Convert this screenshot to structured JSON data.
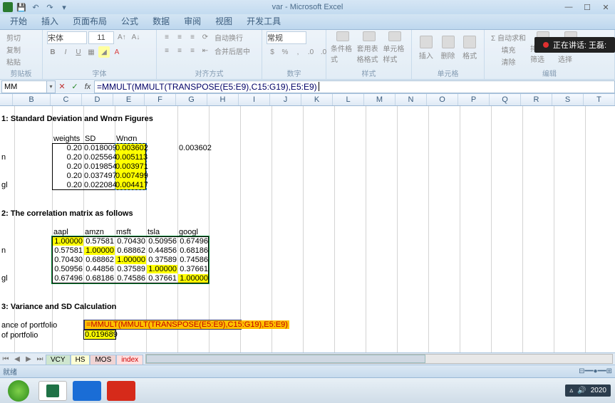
{
  "app": {
    "title": "var - Microsoft Excel"
  },
  "qat": {
    "save": "save",
    "undo": "undo",
    "redo": "redo"
  },
  "tabs": [
    "开始",
    "插入",
    "页面布局",
    "公式",
    "数据",
    "审阅",
    "视图",
    "开发工具"
  ],
  "clipboard": {
    "cut": "剪切",
    "copy": "复制",
    "paste": "粘贴",
    "label": "剪贴板"
  },
  "font": {
    "name": "宋体",
    "size": "11",
    "label": "字体"
  },
  "align": {
    "label": "对齐方式",
    "wrap": "自动换行",
    "merge": "合并后居中"
  },
  "number": {
    "label": "数字",
    "format": "常规"
  },
  "styles": {
    "label": "样式",
    "cond": "条件格式",
    "table": "套用表格格式",
    "cell": "单元格样式"
  },
  "cells": {
    "label": "单元格",
    "insert": "插入",
    "delete": "删除",
    "format": "格式"
  },
  "editing": {
    "label": "编辑",
    "autosum": "Σ 自动求和",
    "fill": "填充",
    "clear": "清除",
    "sort": "排序和筛选",
    "find": "查找和选择"
  },
  "overlay": {
    "text": "正在讲话: 王磊:"
  },
  "namebox": "MM",
  "formula": "=MMULT(MMULT(TRANSPOSE(E5:E9),C15:G19),E5:E9)",
  "columns": [
    "B",
    "C",
    "D",
    "E",
    "F",
    "G",
    "H",
    "I",
    "J",
    "K",
    "L",
    "M",
    "N",
    "O",
    "P",
    "Q",
    "R",
    "S",
    "T"
  ],
  "sheet": {
    "h1": "1: Standard Deviation and Wnσn Figures",
    "th": {
      "weights": "weights",
      "sd": "SD",
      "wn": "Wnσn"
    },
    "stats": [
      {
        "w": "0.20",
        "sd": "0.018009",
        "wn": "0.003602"
      },
      {
        "w": "0.20",
        "sd": "0.025564",
        "wn": "0.005113"
      },
      {
        "w": "0.20",
        "sd": "0.019854",
        "wn": "0.003971"
      },
      {
        "w": "0.20",
        "sd": "0.037497",
        "wn": "0.007499"
      },
      {
        "w": "0.20",
        "sd": "0.022084",
        "wn": "0.004417"
      }
    ],
    "extra": "0.003602",
    "label_gl": "gl",
    "label_n": "n",
    "h2": "2: The correlation matrix as follows",
    "corr_hdr": [
      "aapl",
      "amzn",
      "msft",
      "tsla",
      "googl"
    ],
    "corr": [
      [
        "1.00000",
        "0.57581",
        "0.70430",
        "0.50956",
        "0.67496"
      ],
      [
        "0.57581",
        "1.00000",
        "0.68862",
        "0.44856",
        "0.68186"
      ],
      [
        "0.70430",
        "0.68862",
        "1.00000",
        "0.37589",
        "0.74586"
      ],
      [
        "0.50956",
        "0.44856",
        "0.37589",
        "1.00000",
        "0.37661"
      ],
      [
        "0.67496",
        "0.68186",
        "0.74586",
        "0.37661",
        "1.00000"
      ]
    ],
    "h3": "3: Variance and SD Calculation",
    "lbl_var": "ance of portfolio",
    "lbl_sd": "of portfolio",
    "formula_vis": "=MMULT(MMULT(TRANSPOSE(E5:E9),C15:G19),E5:E9)",
    "sd_result": "0.019689"
  },
  "sheettabs": [
    "VCY",
    "HS",
    "MOS",
    "index"
  ],
  "status": {
    "ready": "就绪"
  },
  "tray": {
    "time": "2020"
  }
}
